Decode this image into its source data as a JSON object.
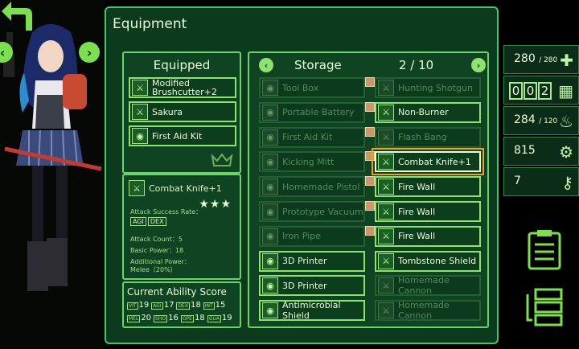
{
  "screen_title": "Equipment",
  "equipped": {
    "title": "Equipped",
    "items": [
      {
        "label": "Modified\nBrushcutter+2",
        "icon": "sword-icon"
      },
      {
        "label": "Sakura",
        "icon": "sword-icon"
      },
      {
        "label": "First Aid Kit",
        "icon": "eye-icon"
      }
    ]
  },
  "detail": {
    "name": "Combat Knife+1",
    "stars": "★★★",
    "attack_rate_label": "Attack Success Rate：",
    "attack_rate_tags": [
      "AGI",
      "DEX"
    ],
    "attack_count": "Attack Count：5",
    "basic_power": "Basic Power：18",
    "additional_power_label": "Additional Power：",
    "additional_power_value": "Melee（20%）"
  },
  "ability": {
    "title": "Current Ability Score",
    "row1": [
      {
        "tag": "VIT",
        "value": "19"
      },
      {
        "tag": "AGI",
        "value": "17"
      },
      {
        "tag": "DEX",
        "value": "18"
      },
      {
        "tag": "INT",
        "value": "15"
      }
    ],
    "row2": [
      {
        "tag": "MEL",
        "value": "20"
      },
      {
        "tag": "SHO",
        "value": "16"
      },
      {
        "tag": "OPE",
        "value": "18"
      },
      {
        "tag": "GUA",
        "value": "19"
      }
    ]
  },
  "storage": {
    "title": "Storage",
    "page": "2 / 10",
    "left_column": [
      {
        "label": "Tool Box",
        "state": "off",
        "thumb": true
      },
      {
        "label": "Portable Battery",
        "state": "off",
        "thumb": true
      },
      {
        "label": "First Aid Kit",
        "state": "off",
        "thumb": true
      },
      {
        "label": "Kicking Mitt",
        "state": "off",
        "thumb": true
      },
      {
        "label": "Homemade Pistol",
        "state": "off",
        "thumb": true
      },
      {
        "label": "Prototype Vacuum",
        "state": "off",
        "thumb": true
      },
      {
        "label": "Iron Pipe",
        "state": "off",
        "thumb": true
      },
      {
        "label": "3D Printer",
        "state": "on",
        "thumb": false
      },
      {
        "label": "3D Printer",
        "state": "on",
        "thumb": false
      },
      {
        "label": "Antimicrobial Shield",
        "state": "on",
        "thumb": false
      }
    ],
    "right_column": [
      {
        "label": "Hunting Shotgun",
        "state": "off"
      },
      {
        "label": "Non-Burner",
        "state": "on"
      },
      {
        "label": "Flash Bang",
        "state": "off"
      },
      {
        "label": "Combat Knife+1",
        "state": "sel"
      },
      {
        "label": "Fire Wall",
        "state": "on"
      },
      {
        "label": "Fire Wall",
        "state": "on"
      },
      {
        "label": "Fire Wall",
        "state": "on"
      },
      {
        "label": "Tombstone Shield",
        "state": "on"
      },
      {
        "label": "Homemade Cannon",
        "state": "off"
      },
      {
        "label": "Homemade Cannon",
        "state": "off"
      }
    ]
  },
  "stats": {
    "hp": "280",
    "hp_max": "/ 280",
    "days_digits": [
      "0",
      "0",
      "2"
    ],
    "food": "284",
    "food_max": "/ 120",
    "parts": "815",
    "keys": "7"
  },
  "colors": {
    "accent": "#8ee36e",
    "frame_bg": "#0b3a1c",
    "select": "#f0a020"
  }
}
